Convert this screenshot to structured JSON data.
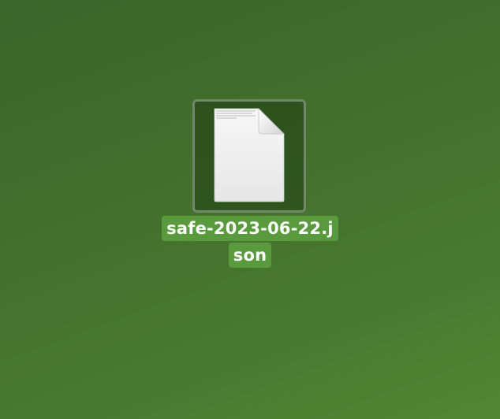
{
  "desktop": {
    "background_color": "#467330",
    "selected_file": {
      "icon": "document-icon",
      "name_line_1": "safe-2023-06-22.j",
      "name_line_2": "son",
      "selected": true,
      "label_highlight_color": "#5a9a3e"
    }
  }
}
